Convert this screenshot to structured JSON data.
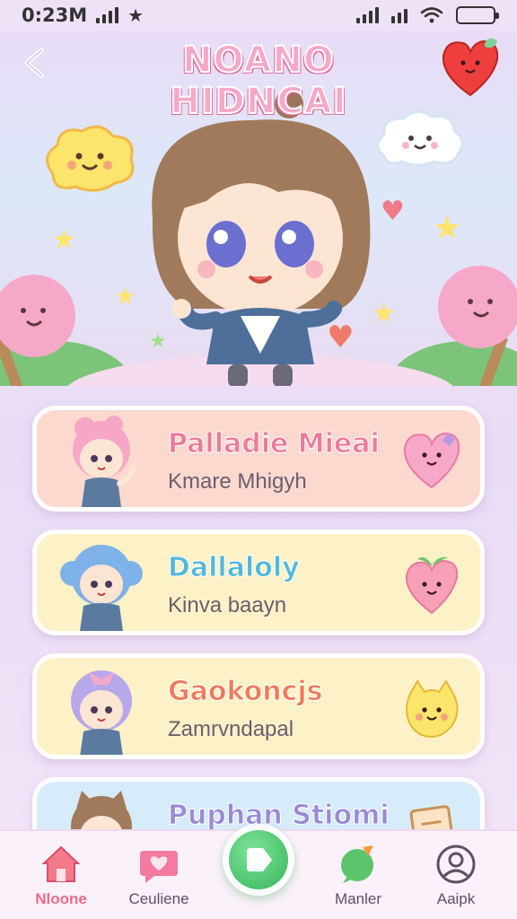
{
  "status_bar": {
    "time": "0:23M"
  },
  "header": {
    "title": "NOANO HIDNCAI"
  },
  "cards": [
    {
      "title": "Palladie Mieai",
      "subtitle": "Kmare Mhigyh",
      "bg": "#fbd9cf",
      "title_color": "#ee7a9a"
    },
    {
      "title": "Dallaloly",
      "subtitle": "Kinva baayn",
      "bg": "#fdf2c7",
      "title_color": "#52b7dc"
    },
    {
      "title": "Gaokoncjs",
      "subtitle": "Zamrvndapal",
      "bg": "#fdf2c7",
      "title_color": "#f07a5a"
    },
    {
      "title": "Puphan Stiomi",
      "subtitle": "",
      "bg": "#d7ecfb",
      "title_color": "#9a8ad6"
    }
  ],
  "nav": [
    {
      "label": "Nloone",
      "icon": "home-icon",
      "active": true
    },
    {
      "label": "Ceuliene",
      "icon": "heart-chat-icon",
      "active": false
    },
    {
      "label": "Manler",
      "icon": "chat-bubble-icon",
      "active": false
    },
    {
      "label": "Aaipk",
      "icon": "profile-icon",
      "active": false
    }
  ]
}
